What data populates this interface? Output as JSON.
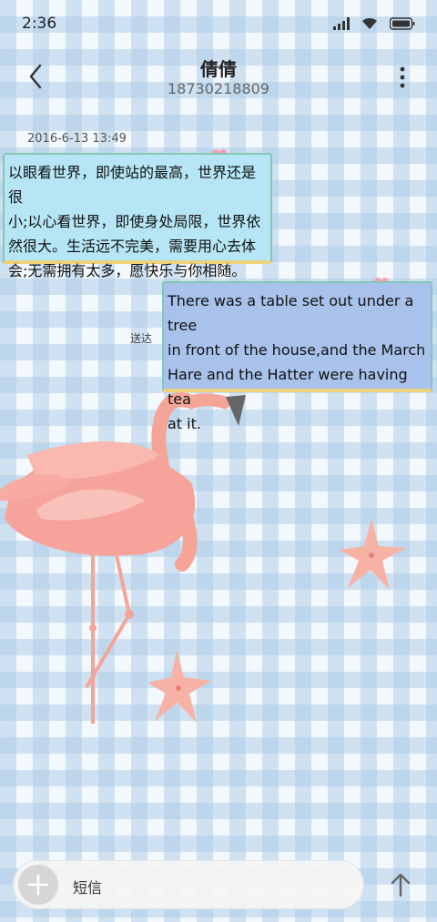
{
  "status_bar": {
    "time": "2:36",
    "icons": [
      "signal-icon",
      "wifi-icon",
      "battery-icon"
    ]
  },
  "header": {
    "contact_name": "倩倩",
    "phone_number": "18730218809",
    "back_icon": "back-arrow-icon",
    "more_icon": "more-vertical-icon"
  },
  "conversation": {
    "date": "2016-6-13 13:49",
    "messages": [
      {
        "direction": "incoming",
        "lines": [
          "以眼看世界，即使站的最高，世界还是很",
          "小;以心看世界，即使身处局限，世界依",
          "然很大。生活远不完美，需要用心去体",
          "会;无需拥有太多，愿快乐与你相随。"
        ]
      },
      {
        "direction": "outgoing",
        "lines": [
          "There was a table set out under a tree",
          "in front of the house,and the March",
          "Hare and the Hatter were having tea",
          "at it."
        ],
        "status": "送达"
      }
    ]
  },
  "composer": {
    "placeholder": "短信",
    "attach_icon": "plus-icon",
    "send_icon": "send-arrow-icon"
  },
  "colors": {
    "incoming_bubble": "#b6e6f6",
    "outgoing_bubble": "#a8c2ec",
    "bubble_border": "#84c7b2",
    "bubble_bottom": "#ecd27a",
    "heart": "#f4a0b0",
    "flamingo": "#f4a597"
  }
}
